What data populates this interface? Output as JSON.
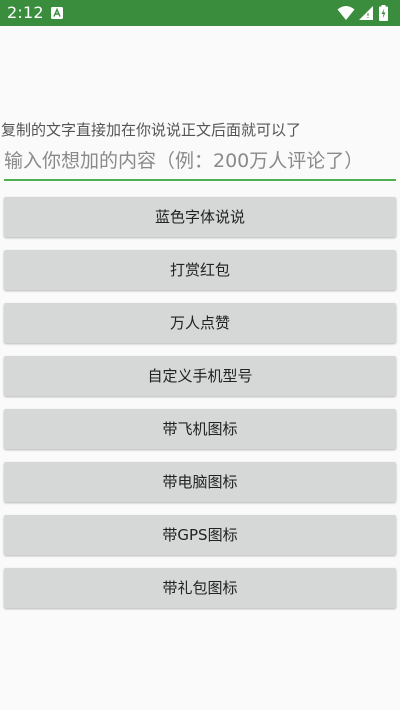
{
  "status_bar": {
    "time": "2:12",
    "background": "#3a8d3c",
    "icons": [
      "notification-a-icon",
      "wifi-icon",
      "signal-icon",
      "battery-charging-icon"
    ]
  },
  "hint": "复制的文字直接加在你说说正文后面就可以了",
  "input": {
    "value": "",
    "placeholder": "输入你想加的内容（例：200万人评论了）",
    "underline_color": "#4caf50"
  },
  "buttons": [
    {
      "label": "蓝色字体说说"
    },
    {
      "label": "打赏红包"
    },
    {
      "label": "万人点赞"
    },
    {
      "label": "自定义手机型号"
    },
    {
      "label": "带飞机图标"
    },
    {
      "label": "带电脑图标"
    },
    {
      "label": "带GPS图标"
    },
    {
      "label": "带礼包图标"
    }
  ]
}
